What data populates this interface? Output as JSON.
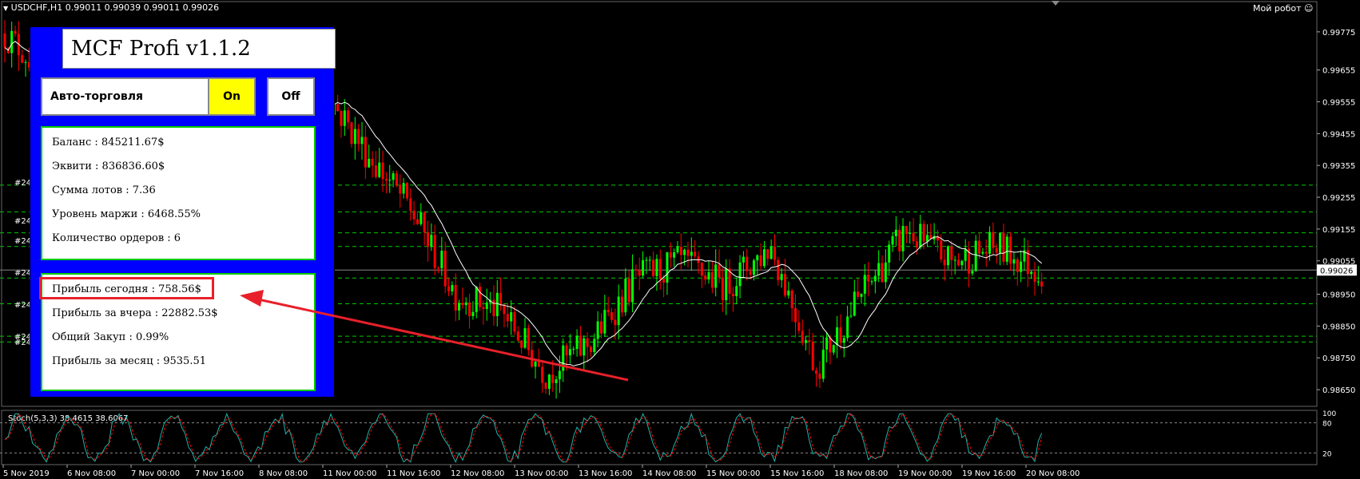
{
  "header": {
    "symbol_info": "USDCHF,H1  0.99011 0.99039 0.99011 0.99026",
    "robot_label": "Мой робот"
  },
  "panel": {
    "title": "MCF Profi v1.1.2",
    "auto_trading_label": "Авто-торговля",
    "on_label": "On",
    "off_label": "Off",
    "stats": [
      "Баланс : 845211.67$",
      "Эквити : 836836.60$",
      "Сумма лотов : 7.36",
      "Уровень маржи : 6468.55%",
      "Количество ордеров : 6"
    ],
    "profits": [
      "Прибыль сегодня : 758.56$",
      "Прибыль за вчера : 22882.53$",
      "Общий Закуп : 0.99%",
      "Прибыль за месяц : 9535.51"
    ]
  },
  "colors": {
    "bull": "#00ff00",
    "bear": "#ff0000",
    "ma": "#ffffff",
    "level": "#00cc00",
    "panel_bg": "#0000ff",
    "arrow": "#e8202a",
    "stoch_main": "#20b2aa",
    "stoch_signal": "#ff0000"
  },
  "chart_data": {
    "type": "candlestick",
    "symbol": "USDCHF",
    "timeframe": "H1",
    "current_price": "0.99026",
    "y_ticks": [
      "0.99775",
      "0.99655",
      "0.99555",
      "0.99455",
      "0.99355",
      "0.99255",
      "0.99155",
      "0.99055",
      "0.98950",
      "0.98850",
      "0.98750",
      "0.98650"
    ],
    "x_ticks": [
      "5 Nov 2019",
      "6 Nov 08:00",
      "7 Nov 00:00",
      "7 Nov 16:00",
      "8 Nov 08:00",
      "11 Nov 00:00",
      "11 Nov 16:00",
      "12 Nov 08:00",
      "13 Nov 00:00",
      "13 Nov 16:00",
      "14 Nov 08:00",
      "15 Nov 00:00",
      "15 Nov 16:00",
      "18 Nov 08:00",
      "19 Nov 00:00",
      "19 Nov 16:00",
      "20 Nov 08:00"
    ],
    "order_labels": [
      "#24",
      "#24",
      "#24",
      "#24",
      "#24",
      "#24",
      "#24"
    ],
    "level_lines": [
      0.99293,
      0.99209,
      0.99143,
      0.991,
      0.99001,
      0.9892,
      0.98818,
      0.988
    ],
    "anchor_prices": [
      0.9977,
      0.9963,
      0.995,
      0.9946,
      0.9935,
      0.9931,
      0.9943,
      0.9961,
      0.994,
      0.9922,
      0.9895,
      0.989,
      0.987,
      0.988,
      0.99,
      0.9905,
      0.9898,
      0.991,
      0.9872,
      0.9895,
      0.9915,
      0.9905,
      0.991,
      0.9902
    ],
    "stochastic": {
      "label": "Stoch(5,3,3) 38.4615 38.6067",
      "levels": [
        "100",
        "80",
        "20"
      ]
    }
  }
}
